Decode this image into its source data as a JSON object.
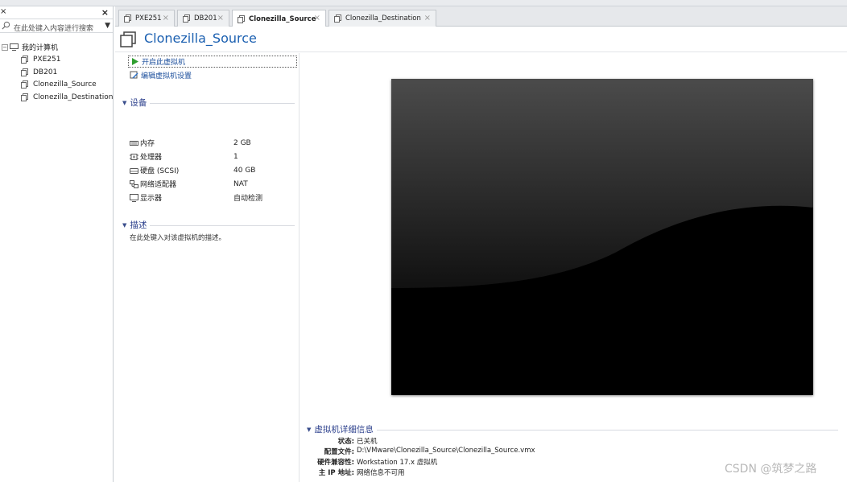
{
  "sidebar": {
    "search_placeholder": "在此处键入内容进行搜索",
    "root_label": "我的计算机",
    "items": [
      {
        "label": "PXE251"
      },
      {
        "label": "DB201"
      },
      {
        "label": "Clonezilla_Source"
      },
      {
        "label": "Clonezilla_Destination"
      }
    ]
  },
  "tabs": [
    {
      "label": "PXE251"
    },
    {
      "label": "DB201"
    },
    {
      "label": "Clonezilla_Source"
    },
    {
      "label": "Clonezilla_Destination"
    }
  ],
  "vm": {
    "title": "Clonezilla_Source",
    "actions": {
      "start": "开启此虚拟机",
      "edit": "编辑虚拟机设置"
    },
    "devices_heading": "设备",
    "devices": [
      {
        "name": "内存",
        "value": "2 GB",
        "icon": "memory-icon"
      },
      {
        "name": "处理器",
        "value": "1",
        "icon": "cpu-icon"
      },
      {
        "name": "硬盘 (SCSI)",
        "value": "40 GB",
        "icon": "disk-icon"
      },
      {
        "name": "网络适配器",
        "value": "NAT",
        "icon": "network-icon"
      },
      {
        "name": "显示器",
        "value": "自动检测",
        "icon": "display-icon"
      }
    ],
    "description_heading": "描述",
    "description_placeholder": "在此处键入对该虚拟机的描述。",
    "details_heading": "虚拟机详细信息",
    "details": [
      {
        "key": "状态:",
        "value": "已关机"
      },
      {
        "key": "配置文件:",
        "value": "D:\\VMware\\Clonezilla_Source\\Clonezilla_Source.vmx"
      },
      {
        "key": "硬件兼容性:",
        "value": "Workstation 17.x 虚拟机"
      },
      {
        "key": "主 IP 地址:",
        "value": "网络信息不可用"
      }
    ]
  },
  "watermark": "CSDN @筑梦之路",
  "colors": {
    "title_blue": "#1a5fb0",
    "section_blue": "#2b3f8c",
    "action_blue": "#1c4f9c",
    "start_green": "#2f9e2f"
  }
}
